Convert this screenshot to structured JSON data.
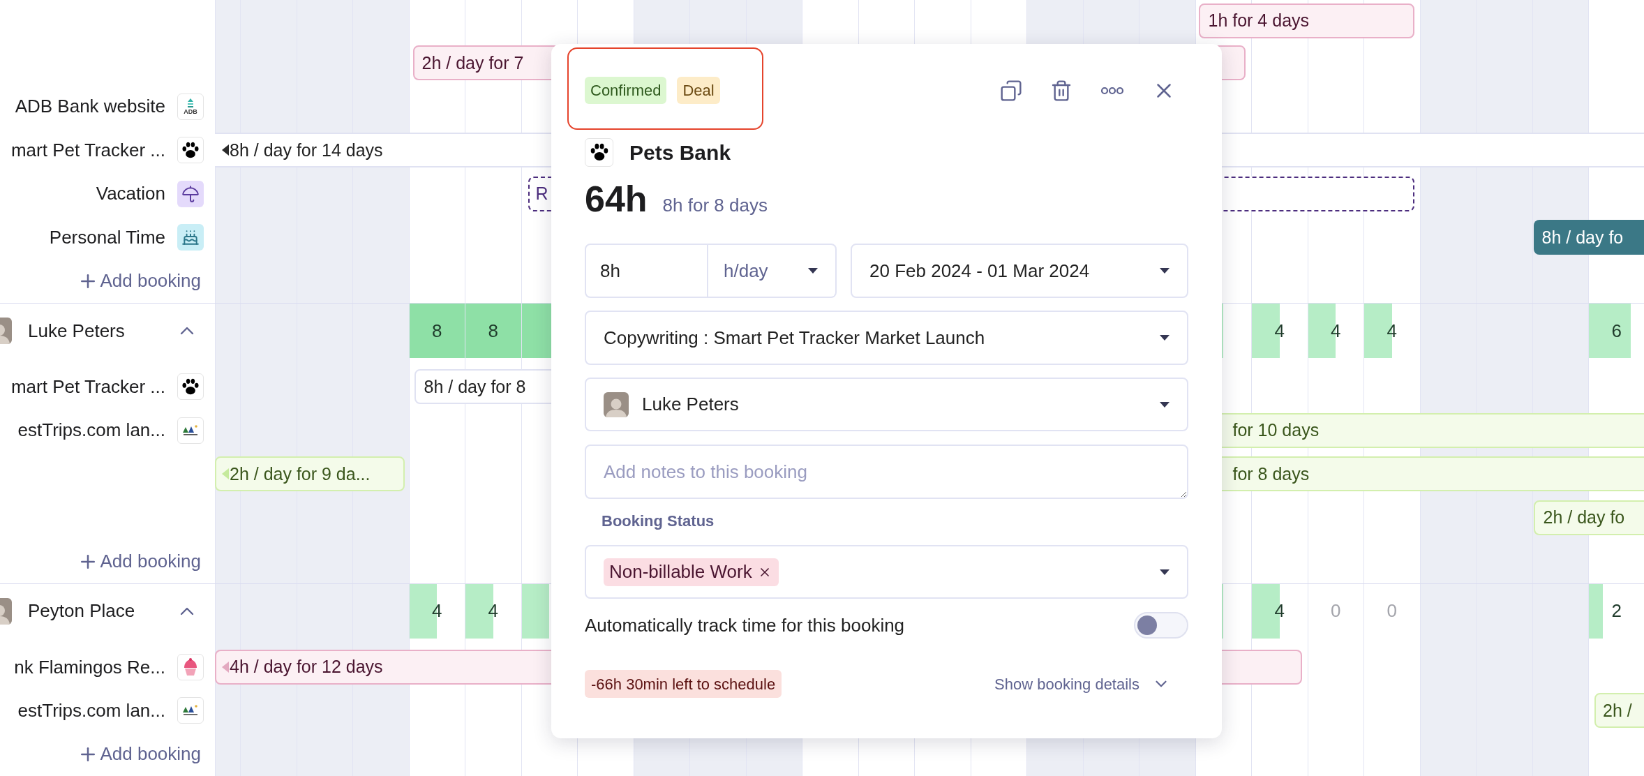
{
  "days": [
    {
      "shaded": true
    },
    {
      "shaded": true
    },
    {
      "shaded": true
    },
    {
      "shaded": true
    },
    {
      "shaded": false
    },
    {
      "shaded": false
    },
    {
      "shaded": false
    },
    {
      "shaded": false
    },
    {
      "shaded": true
    },
    {
      "shaded": true
    },
    {
      "shaded": true
    },
    {
      "shaded": false
    },
    {
      "shaded": false
    },
    {
      "shaded": false
    },
    {
      "shaded": false
    },
    {
      "shaded": true
    },
    {
      "shaded": true
    },
    {
      "shaded": true
    },
    {
      "shaded": false
    },
    {
      "shaded": false
    },
    {
      "shaded": false
    },
    {
      "shaded": false
    },
    {
      "shaded": true
    },
    {
      "shaded": true
    },
    {
      "shaded": true
    },
    {
      "shaded": false
    }
  ],
  "sections": [
    {
      "rows": [
        {
          "kind": "blank",
          "bars": [
            {
              "text": "1h for 4 days",
              "kind": "pink",
              "continues_left": false
            }
          ]
        },
        {
          "kind": "blank",
          "bars": [
            {
              "text": "2h / day for 7",
              "kind": "pink",
              "continues_left": false
            }
          ]
        },
        {
          "kind": "project",
          "label": "ADB Bank website",
          "logo": {
            "kind": "adb",
            "text": "ADB"
          }
        },
        {
          "kind": "project",
          "label": "mart Pet Tracker ...",
          "logo": {
            "kind": "paw"
          },
          "bars": [
            {
              "text": "8h / day for 14 days",
              "kind": "band",
              "continues_left": true
            }
          ]
        },
        {
          "kind": "project",
          "label": "Vacation",
          "logo": {
            "kind": "umbrella"
          },
          "bars": [
            {
              "text": "R",
              "kind": "dashed",
              "continues_left": false
            }
          ]
        },
        {
          "kind": "project",
          "label": "Personal Time",
          "logo": {
            "kind": "cake"
          },
          "bars": [
            {
              "text": "8h / day fo",
              "kind": "teal",
              "continues_left": false
            }
          ]
        },
        {
          "kind": "add",
          "label": "Add booking"
        }
      ]
    },
    {
      "person": {
        "name": "Luke Peters",
        "expanded": true
      },
      "cells": [
        {
          "value": "8",
          "level": 1
        },
        {
          "value": "8",
          "level": 1
        },
        {
          "level": 1
        },
        {
          "level": 0.5
        },
        {
          "value": "4",
          "level": 0.5
        },
        {
          "value": "4",
          "level": 0.5
        },
        {
          "value": "4",
          "level": 0.5
        },
        {
          "value": "6",
          "level": 0.75
        }
      ],
      "rows": [
        {
          "kind": "project",
          "label": "mart Pet Tracker ...",
          "logo": {
            "kind": "paw"
          },
          "bars": [
            {
              "text": "8h / day for 8",
              "kind": "white",
              "continues_left": false
            }
          ]
        },
        {
          "kind": "project",
          "label": "estTrips.com lan...",
          "logo": {
            "kind": "trips"
          },
          "bars": [
            {
              "text": "for 10 days",
              "kind": "green",
              "continues_left": false
            }
          ]
        },
        {
          "kind": "blank",
          "bars": [
            {
              "text": "2h / day for 9 da...",
              "kind": "green",
              "continues_left": true
            },
            {
              "text": "for 8 days",
              "kind": "green",
              "continues_left": false
            }
          ]
        },
        {
          "kind": "blank",
          "bars": [
            {
              "text": "2h / day fo",
              "kind": "green",
              "continues_left": false
            }
          ]
        },
        {
          "kind": "add",
          "label": "Add booking"
        }
      ]
    },
    {
      "person": {
        "name": "Peyton Place",
        "expanded": true
      },
      "cells": [
        {
          "value": "4",
          "level": 0.5
        },
        {
          "value": "4",
          "level": 0.5
        },
        {
          "level": 0.5
        },
        {
          "level": 0.5
        },
        {
          "value": "4",
          "level": 0.5
        },
        {
          "value": "0"
        },
        {
          "value": "0"
        },
        {
          "value": "2",
          "level": 0.25
        }
      ],
      "rows": [
        {
          "kind": "project",
          "label": "nk Flamingos Re...",
          "logo": {
            "kind": "cupcake"
          },
          "bars": [
            {
              "text": "4h / day for 12 days",
              "kind": "pink",
              "continues_left": true
            }
          ]
        },
        {
          "kind": "project",
          "label": "estTrips.com lan...",
          "logo": {
            "kind": "trips"
          },
          "bars": [
            {
              "text": "2h /",
              "kind": "green",
              "continues_left": false
            }
          ]
        },
        {
          "kind": "add",
          "label": "Add booking"
        }
      ]
    }
  ],
  "popup": {
    "tags": [
      {
        "text": "Confirmed",
        "kind": "confirmed"
      },
      {
        "text": "Deal",
        "kind": "deal"
      }
    ],
    "project": {
      "name": "Pets Bank",
      "logo": {
        "kind": "paw"
      }
    },
    "total": "64h",
    "summary": "8h for 8 days",
    "hours": {
      "value": "8h"
    },
    "unit": "h/day",
    "dates": "20 Feb 2024 - 01 Mar 2024",
    "task": "Copywriting : Smart Pet Tracker Market Launch",
    "person": "Luke Peters",
    "notes": {
      "placeholder": "Add notes to this booking"
    },
    "status_label": "Booking Status",
    "status_tags": [
      "Non-billable Work"
    ],
    "auto_track": {
      "label": "Automatically track time for this booking",
      "on": false
    },
    "remaining": "-66h 30min left to schedule",
    "details_link": "Show booking details"
  }
}
